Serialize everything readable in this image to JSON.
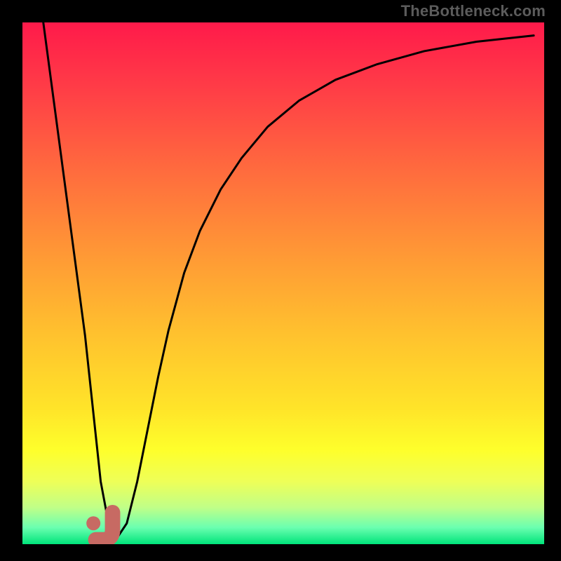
{
  "watermark": "TheBottleneck.com",
  "chart_data": {
    "type": "line",
    "title": "",
    "xlabel": "",
    "ylabel": "",
    "xlim": [
      0,
      100
    ],
    "ylim": [
      0,
      100
    ],
    "grid": false,
    "legend": false,
    "background_gradient": {
      "stops": [
        {
          "pos": 0.0,
          "color": "#ff1a4a"
        },
        {
          "pos": 0.12,
          "color": "#ff3b47"
        },
        {
          "pos": 0.28,
          "color": "#ff6a3e"
        },
        {
          "pos": 0.45,
          "color": "#ff9a35"
        },
        {
          "pos": 0.6,
          "color": "#ffc22e"
        },
        {
          "pos": 0.74,
          "color": "#ffe429"
        },
        {
          "pos": 0.82,
          "color": "#feff2b"
        },
        {
          "pos": 0.88,
          "color": "#eeff58"
        },
        {
          "pos": 0.93,
          "color": "#c0ff88"
        },
        {
          "pos": 0.968,
          "color": "#6bffb0"
        },
        {
          "pos": 1.0,
          "color": "#00e47a"
        }
      ]
    },
    "series": [
      {
        "name": "bottleneck-curve",
        "color": "#000000",
        "x": [
          4,
          6,
          8,
          10,
          12,
          13.5,
          15,
          16.5,
          18,
          20,
          22,
          24,
          26,
          28,
          31,
          34,
          38,
          42,
          47,
          53,
          60,
          68,
          77,
          87,
          98
        ],
        "y": [
          100,
          85,
          70,
          55,
          40,
          26,
          12,
          4,
          1,
          4,
          12,
          22,
          32,
          41,
          52,
          60,
          68,
          74,
          80,
          85,
          89,
          92,
          94.5,
          96.3,
          97.5
        ]
      }
    ],
    "markers": [
      {
        "name": "marker-dot",
        "shape": "circle",
        "x": 13.6,
        "y": 4.0,
        "size": 10,
        "color": "#c76a63"
      },
      {
        "name": "marker-j",
        "shape": "j",
        "x": 16.2,
        "y": 2.6,
        "size": 28,
        "color": "#c76a63"
      }
    ]
  }
}
